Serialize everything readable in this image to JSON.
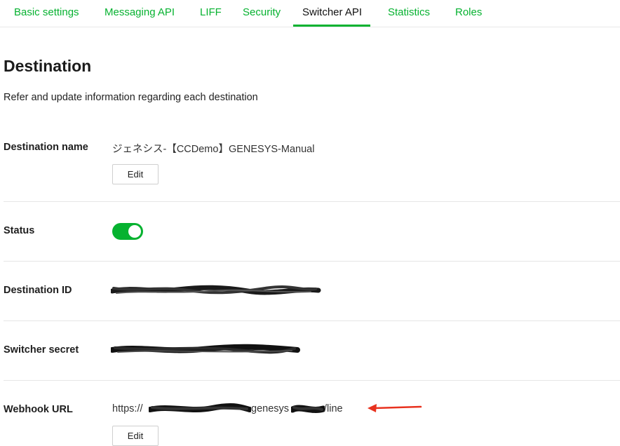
{
  "tabs": [
    {
      "label": "Basic settings"
    },
    {
      "label": "Messaging API"
    },
    {
      "label": "LIFF"
    },
    {
      "label": "Security"
    },
    {
      "label": "Switcher API"
    },
    {
      "label": "Statistics"
    },
    {
      "label": "Roles"
    }
  ],
  "active_tab": "Switcher API",
  "page": {
    "title": "Destination",
    "description": "Refer and update information regarding each destination"
  },
  "fields": {
    "destination_name": {
      "label": "Destination name",
      "value": "ジェネシス-【CCDemo】GENESYS-Manual",
      "edit_label": "Edit"
    },
    "status": {
      "label": "Status",
      "enabled": true
    },
    "destination_id": {
      "label": "Destination ID"
    },
    "switcher_secret": {
      "label": "Switcher secret"
    },
    "webhook_url": {
      "label": "Webhook URL",
      "prefix": "https://",
      "middle": "genesys",
      "suffix": "/line",
      "edit_label": "Edit"
    }
  },
  "colors": {
    "accent": "#06b230",
    "annotation_arrow": "#e8321f"
  }
}
